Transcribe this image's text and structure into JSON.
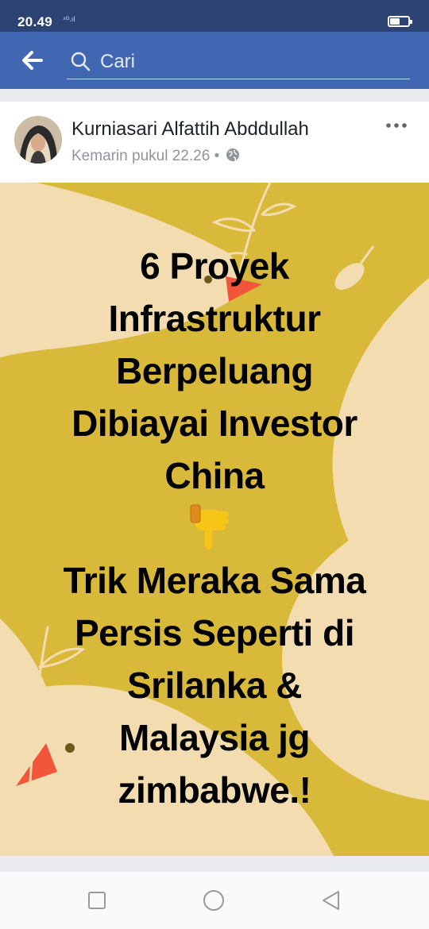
{
  "status_bar": {
    "time": "20.49",
    "signal": "⁴ᴳ.ıl",
    "battery_level": 0.55
  },
  "header": {
    "search_placeholder": "Cari",
    "back_icon": "arrow-left-icon",
    "search_icon": "search-icon"
  },
  "post": {
    "author": "Kurniasari Alfattih Abddullah",
    "timestamp": "Kemarin pukul 22.26",
    "separator": "•",
    "privacy_icon": "globe-icon",
    "more_icon": "more-dots-icon",
    "image_text": {
      "headline": [
        "6 Proyek",
        "Infrastruktur",
        "Berpeluang",
        "Dibiayai Investor",
        "China"
      ],
      "emoji": "👇",
      "body": [
        "Trik Meraka Sama",
        "Persis Seperti di",
        "Srilanka &",
        "Malaysia jg",
        "zimbabwe.!"
      ]
    },
    "colors": {
      "background": "#d9b93a",
      "shapes": "#f6dfb6",
      "beak": "#f2553a",
      "text": "#000000"
    }
  },
  "nav_bar": {
    "recent_icon": "square-icon",
    "home_icon": "circle-icon",
    "back_icon": "triangle-back-icon"
  }
}
